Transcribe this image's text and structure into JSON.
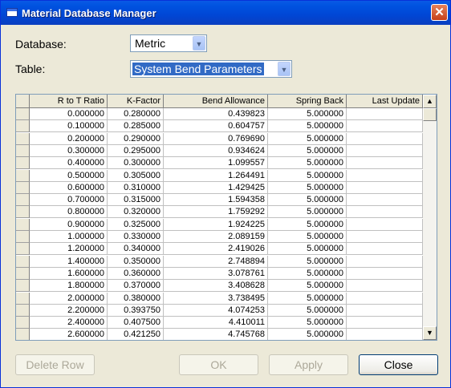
{
  "window": {
    "title": "Material Database Manager",
    "close_glyph": "✕"
  },
  "database": {
    "label": "Database:",
    "value": "Metric"
  },
  "table": {
    "label": "Table:",
    "value": "System Bend Parameters"
  },
  "grid": {
    "columns": [
      "R to T Ratio",
      "K-Factor",
      "Bend Allowance",
      "Spring Back",
      "Last Update"
    ],
    "rows": [
      [
        "0.000000",
        "0.280000",
        "0.439823",
        "5.000000",
        ""
      ],
      [
        "0.100000",
        "0.285000",
        "0.604757",
        "5.000000",
        ""
      ],
      [
        "0.200000",
        "0.290000",
        "0.769690",
        "5.000000",
        ""
      ],
      [
        "0.300000",
        "0.295000",
        "0.934624",
        "5.000000",
        ""
      ],
      [
        "0.400000",
        "0.300000",
        "1.099557",
        "5.000000",
        ""
      ],
      [
        "0.500000",
        "0.305000",
        "1.264491",
        "5.000000",
        ""
      ],
      [
        "0.600000",
        "0.310000",
        "1.429425",
        "5.000000",
        ""
      ],
      [
        "0.700000",
        "0.315000",
        "1.594358",
        "5.000000",
        ""
      ],
      [
        "0.800000",
        "0.320000",
        "1.759292",
        "5.000000",
        ""
      ],
      [
        "0.900000",
        "0.325000",
        "1.924225",
        "5.000000",
        ""
      ],
      [
        "1.000000",
        "0.330000",
        "2.089159",
        "5.000000",
        ""
      ],
      [
        "1.200000",
        "0.340000",
        "2.419026",
        "5.000000",
        ""
      ],
      [
        "1.400000",
        "0.350000",
        "2.748894",
        "5.000000",
        ""
      ],
      [
        "1.600000",
        "0.360000",
        "3.078761",
        "5.000000",
        ""
      ],
      [
        "1.800000",
        "0.370000",
        "3.408628",
        "5.000000",
        ""
      ],
      [
        "2.000000",
        "0.380000",
        "3.738495",
        "5.000000",
        ""
      ],
      [
        "2.200000",
        "0.393750",
        "4.074253",
        "5.000000",
        ""
      ],
      [
        "2.400000",
        "0.407500",
        "4.410011",
        "5.000000",
        ""
      ],
      [
        "2.600000",
        "0.421250",
        "4.745768",
        "5.000000",
        ""
      ]
    ]
  },
  "buttons": {
    "delete_row": "Delete Row",
    "ok": "OK",
    "apply": "Apply",
    "close": "Close"
  },
  "icons": {
    "dropdown": "chevron-down-icon",
    "scroll_up": "arrow-up-icon",
    "scroll_down": "arrow-down-icon"
  },
  "colors": {
    "titlebar": "#0053e0",
    "selection": "#316ac5",
    "dialog_bg": "#ece9d8"
  }
}
